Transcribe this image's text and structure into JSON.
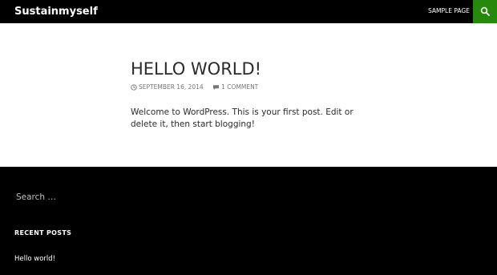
{
  "header": {
    "site_title": "Sustainmyself",
    "nav": [
      {
        "label": "Sample Page"
      }
    ],
    "search_icon": "search-icon",
    "accent_color": "#24890d"
  },
  "post": {
    "title": "HELLO WORLD!",
    "date": "September 16, 2014",
    "comments": "1 Comment",
    "date_icon": "clock-icon",
    "comments_icon": "comment-bubble-icon",
    "body": "Welcome to WordPress. This is your first post. Edit or delete it, then start blogging!"
  },
  "footer": {
    "search": {
      "placeholder": "Search …"
    },
    "recent_posts": {
      "title": "Recent Posts",
      "items": [
        {
          "label": "Hello world!"
        }
      ]
    }
  }
}
